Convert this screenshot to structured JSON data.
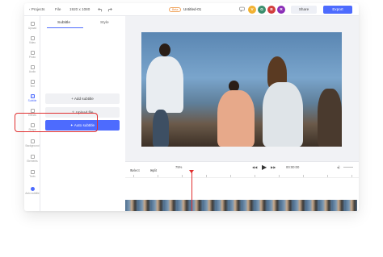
{
  "topbar": {
    "projects": "‹ Projects",
    "file": "File",
    "resolution": "1920 x 1080",
    "beta": "Beta",
    "title": "Untitled-01",
    "avatars": [
      {
        "letter": "V",
        "color": "#f2b233"
      },
      {
        "letter": "G",
        "color": "#3c8f6e"
      },
      {
        "letter": "B",
        "color": "#d23d3d"
      },
      {
        "letter": "R",
        "color": "#8b2fb8"
      }
    ],
    "share": "Share",
    "export": "Export"
  },
  "rail": {
    "items": [
      {
        "label": "Upload",
        "icon": "upload-icon"
      },
      {
        "label": "Video",
        "icon": "video-icon"
      },
      {
        "label": "Photo",
        "icon": "photo-icon"
      },
      {
        "label": "Audio",
        "icon": "audio-icon"
      },
      {
        "label": "Text",
        "icon": "text-icon"
      },
      {
        "label": "Subtitle",
        "icon": "subtitle-icon"
      },
      {
        "label": "Effects",
        "icon": "effects-icon"
      },
      {
        "label": "Shape",
        "icon": "shape-icon"
      },
      {
        "label": "Background",
        "icon": "background-icon"
      },
      {
        "label": "Elements",
        "icon": "elements-icon"
      },
      {
        "label": "Tools",
        "icon": "tools-icon"
      },
      {
        "label": "Auto subtitle",
        "icon": "auto-subtitle-icon"
      }
    ]
  },
  "panel": {
    "tabs": [
      "Subtitle",
      "Style"
    ],
    "add_subtitle": "+ Add subtitle",
    "upload_file": "Upload file",
    "auto_subtitle": "Auto subtitle"
  },
  "timeline": {
    "select": "Select",
    "split": "Split",
    "zoom": "75%",
    "time": "00:00:00"
  }
}
